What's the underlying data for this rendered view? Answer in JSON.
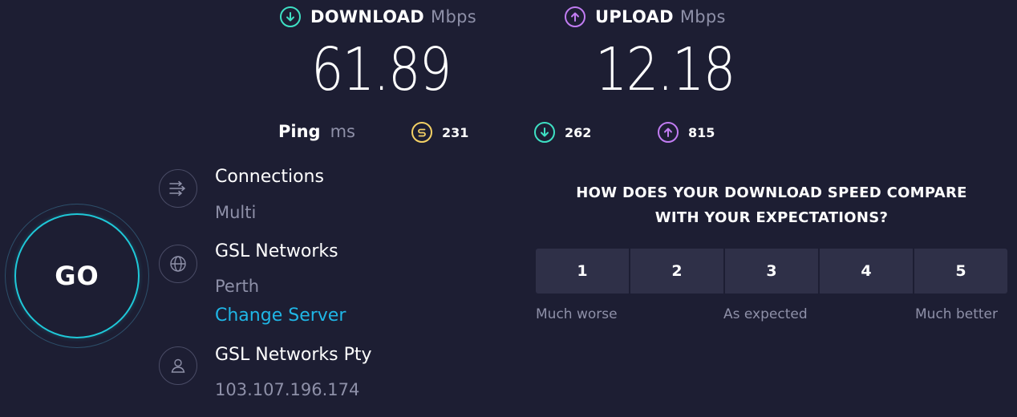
{
  "download": {
    "label": "DOWNLOAD",
    "unit": "Mbps",
    "value": "61.89",
    "icon": "download-arrow-icon",
    "color": "#3ee0c4"
  },
  "upload": {
    "label": "UPLOAD",
    "unit": "Mbps",
    "value": "12.18",
    "icon": "upload-arrow-icon",
    "color": "#c17cf2"
  },
  "ping": {
    "label": "Ping",
    "unit": "ms",
    "idle": {
      "value": "231",
      "icon": "ping-idle-icon",
      "color": "#f4d165"
    },
    "download": {
      "value": "262",
      "icon": "ping-download-icon",
      "color": "#3ee0c4"
    },
    "upload": {
      "value": "815",
      "icon": "ping-upload-icon",
      "color": "#c17cf2"
    }
  },
  "go_button": {
    "label": "GO",
    "ring_color": "#1fc8d8"
  },
  "connections": {
    "title": "Connections",
    "value": "Multi",
    "icon": "connections-arrows-icon"
  },
  "server": {
    "name": "GSL Networks",
    "location": "Perth",
    "change_label": "Change Server",
    "icon": "globe-icon"
  },
  "provider": {
    "name": "GSL Networks Pty",
    "ip": "103.107.196.174",
    "icon": "user-icon"
  },
  "survey": {
    "question_line1": "HOW DOES YOUR DOWNLOAD SPEED COMPARE",
    "question_line2": "WITH YOUR EXPECTATIONS?",
    "ratings": [
      "1",
      "2",
      "3",
      "4",
      "5"
    ],
    "caption_low": "Much worse",
    "caption_mid": "As expected",
    "caption_high": "Much better"
  }
}
